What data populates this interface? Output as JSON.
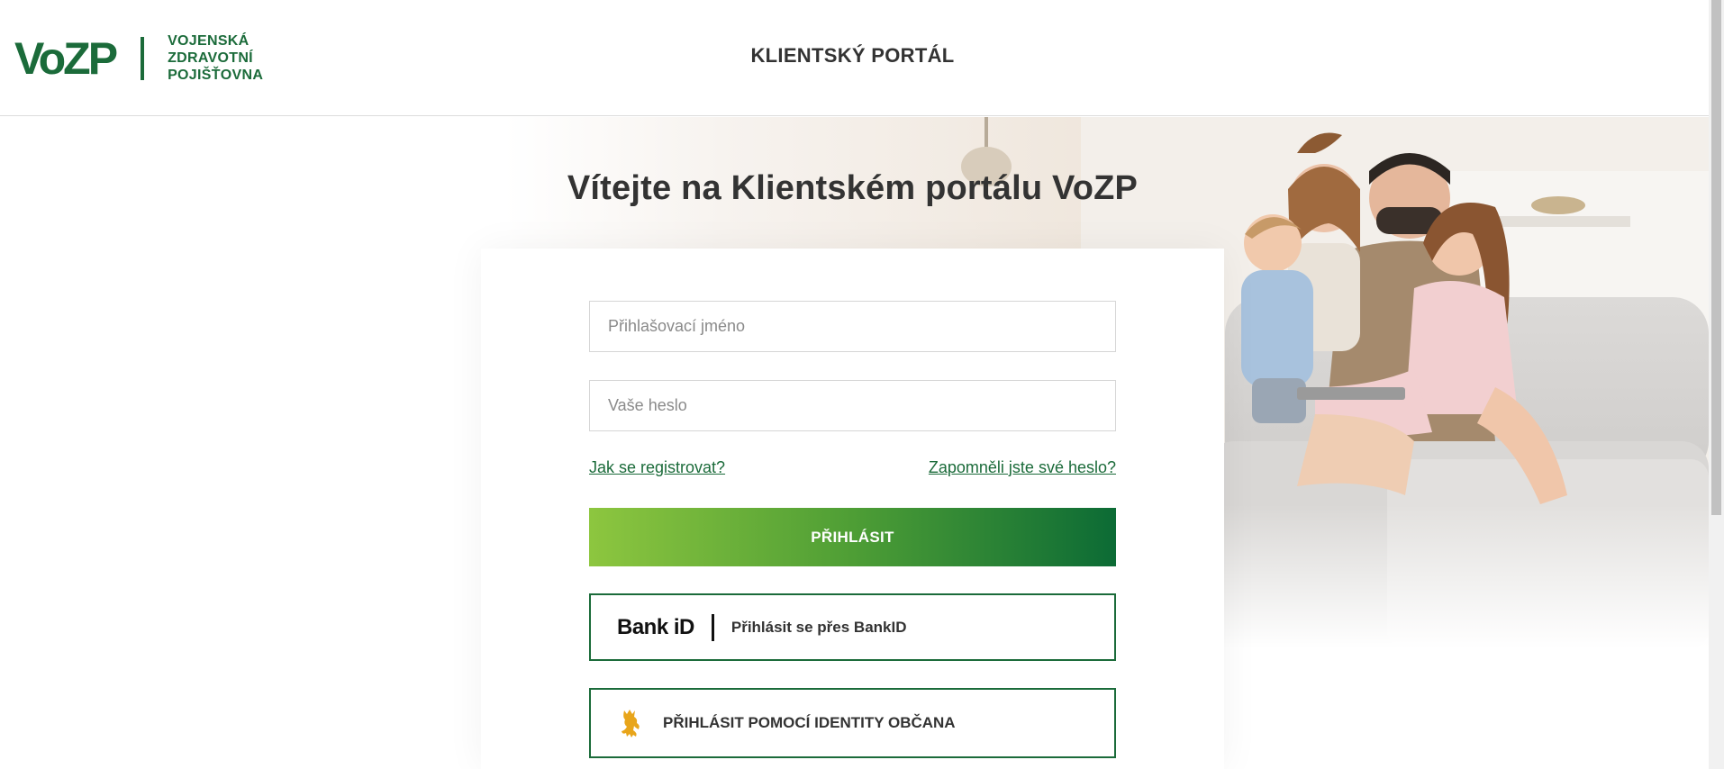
{
  "header": {
    "logo_word": "VoZP",
    "logo_lines": [
      "VOJENSKÁ",
      "ZDRAVOTNÍ",
      "POJIŠŤOVNA"
    ],
    "title": "KLIENTSKÝ PORTÁL"
  },
  "main": {
    "welcome": "Vítejte na Klientském portálu VoZP",
    "username_placeholder": "Přihlašovací jméno",
    "password_placeholder": "Vaše heslo",
    "register_link": "Jak se registrovat?",
    "forgot_link": "Zapomněli jste své heslo?",
    "login_button": "PŘIHLÁSIT",
    "bankid_logo": "Bank iD",
    "bankid_button": "Přihlásit se přes BankID",
    "identity_button": "PŘIHLÁSIT POMOCÍ IDENTITY OBČANA"
  },
  "colors": {
    "brand_green": "#1b6b3a",
    "gradient_start": "#8dc63f",
    "gradient_end": "#0c6b35"
  },
  "icons": [
    "czech-lion-icon"
  ]
}
